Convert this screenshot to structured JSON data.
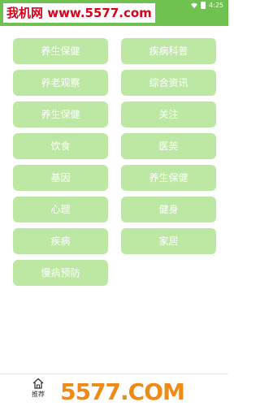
{
  "watermark": {
    "text": "我机网 www.5577.com"
  },
  "status_bar": {
    "time": "4:25"
  },
  "categories": [
    "养生保健",
    "疾病科普",
    "养老观察",
    "综合资讯",
    "养生保健",
    "关注",
    "饮食",
    "医美",
    "基因",
    "养生保健",
    "心理",
    "健身",
    "疾病",
    "家居",
    "慢病预防"
  ],
  "bottom_nav": {
    "home_label": "推荐"
  },
  "logo_overlay": {
    "text": "5577.COM"
  },
  "colors": {
    "status_bar": "#6fc24f",
    "button": "#bde8a4",
    "watermark": "#d9001b",
    "logo": "#f08a14"
  }
}
